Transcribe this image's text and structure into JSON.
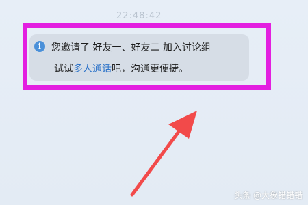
{
  "chat": {
    "timestamp": "22:48:42",
    "notice": {
      "text_prefix": "您邀请了 好友一、好友二 ",
      "text_suffix": "加入讨论组",
      "line2_prefix": "试试",
      "link_text": "多人通话",
      "line2_suffix": "吧，沟通更便捷。"
    }
  },
  "annotation": {
    "box_color": "#e31fe0",
    "arrow_color": "#f24a4a"
  },
  "watermark": "头条 @大象错错错",
  "icons": {
    "info": "info-icon"
  }
}
